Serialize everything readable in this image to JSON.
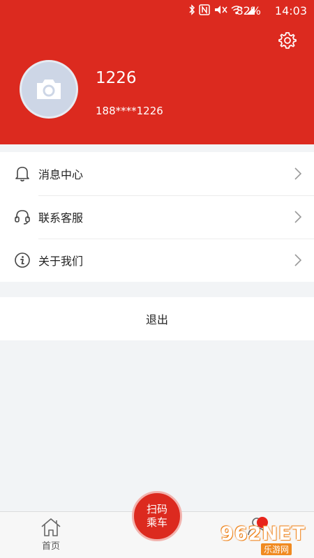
{
  "status_bar": {
    "battery": "82%",
    "time": "14:03"
  },
  "profile": {
    "name": "1226",
    "phone": "188****1226"
  },
  "menu": {
    "items": [
      {
        "label": "消息中心",
        "icon": "bell-icon"
      },
      {
        "label": "联系客服",
        "icon": "headset-icon"
      },
      {
        "label": "关于我们",
        "icon": "info-icon"
      }
    ]
  },
  "logout_label": "退出",
  "tabbar": {
    "home_label": "首页",
    "scan_line1": "扫码",
    "scan_line2": "乘车"
  },
  "watermark": {
    "brand": "962NET",
    "sub": "乐游网"
  },
  "colors": {
    "header_red": "#dc2a1f",
    "background": "#f2f4f6"
  }
}
